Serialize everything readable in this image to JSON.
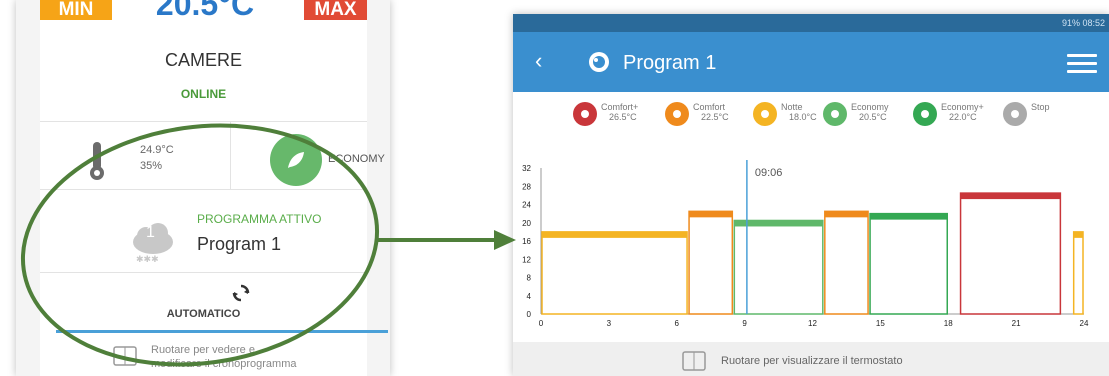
{
  "left": {
    "min_label": "MIN",
    "max_label": "MAX",
    "top_temp": "20.5°C",
    "zone_name": "CAMERE",
    "zone_status": "ONLINE",
    "current_temp": "24.9°C",
    "current_humidity": "35%",
    "mode_label": "ECONOMY",
    "cloud_number": "1",
    "program_status": "PROGRAMMA ATTIVO",
    "program_name": "Program 1",
    "operating_mode": "AUTOMATICO",
    "rotate_hint_line1": "Ruotare per vedere e",
    "rotate_hint_line2": "modificare il cronoprogramma",
    "colors": {
      "min": "#f6a417",
      "max": "#e14b35",
      "online": "#4a9a3a",
      "eco": "#67b86b"
    }
  },
  "right": {
    "status_bar": "91% 08:52",
    "back_icon": "back-arrow-icon",
    "title": "Program 1",
    "menu_icon": "hamburger-menu-icon",
    "rotate_hint": "Ruotare per visualizzare il termostato",
    "legend": [
      {
        "name": "Comfort+",
        "temp": "26.5°C",
        "color": "#c9363a",
        "icon": "sofa-icon"
      },
      {
        "name": "Comfort",
        "temp": "22.5°C",
        "color": "#ef8a1c",
        "icon": "person-icon"
      },
      {
        "name": "Notte",
        "temp": "18.0°C",
        "color": "#f4b423",
        "icon": "moon-icon"
      },
      {
        "name": "Economy",
        "temp": "20.5°C",
        "color": "#5fb86a",
        "icon": "leaf-icon"
      },
      {
        "name": "Economy+",
        "temp": "22.0°C",
        "color": "#34a853",
        "icon": "leaf-plus-icon"
      },
      {
        "name": "Stop",
        "temp": "",
        "color": "#aaaaaa",
        "icon": "stop-icon"
      }
    ],
    "current_time": "09:06"
  },
  "chart_data": {
    "type": "bar",
    "xlim": [
      0,
      24
    ],
    "ylim": [
      0,
      32
    ],
    "x_ticks": [
      "0",
      "3",
      "6",
      "9",
      "12",
      "15",
      "18",
      "21",
      "24"
    ],
    "y_ticks": [
      "0",
      "4",
      "8",
      "12",
      "16",
      "20",
      "24",
      "28",
      "32"
    ],
    "current_time_hours": 9.1,
    "segments": [
      {
        "start": 0,
        "end": 6.5,
        "value": 18.0,
        "mode": "Notte",
        "color": "#f4b423"
      },
      {
        "start": 6.5,
        "end": 8.5,
        "value": 22.5,
        "mode": "Comfort",
        "color": "#ef8a1c"
      },
      {
        "start": 8.5,
        "end": 12.5,
        "value": 20.5,
        "mode": "Economy",
        "color": "#5fb86a"
      },
      {
        "start": 12.5,
        "end": 14.5,
        "value": 22.5,
        "mode": "Comfort",
        "color": "#ef8a1c"
      },
      {
        "start": 14.5,
        "end": 18,
        "value": 22.0,
        "mode": "Economy+",
        "color": "#34a853"
      },
      {
        "start": 18.5,
        "end": 23,
        "value": 26.5,
        "mode": "Comfort+",
        "color": "#c9363a"
      },
      {
        "start": 23.5,
        "end": 24,
        "value": 18.0,
        "mode": "Notte",
        "color": "#f4b423"
      }
    ]
  }
}
